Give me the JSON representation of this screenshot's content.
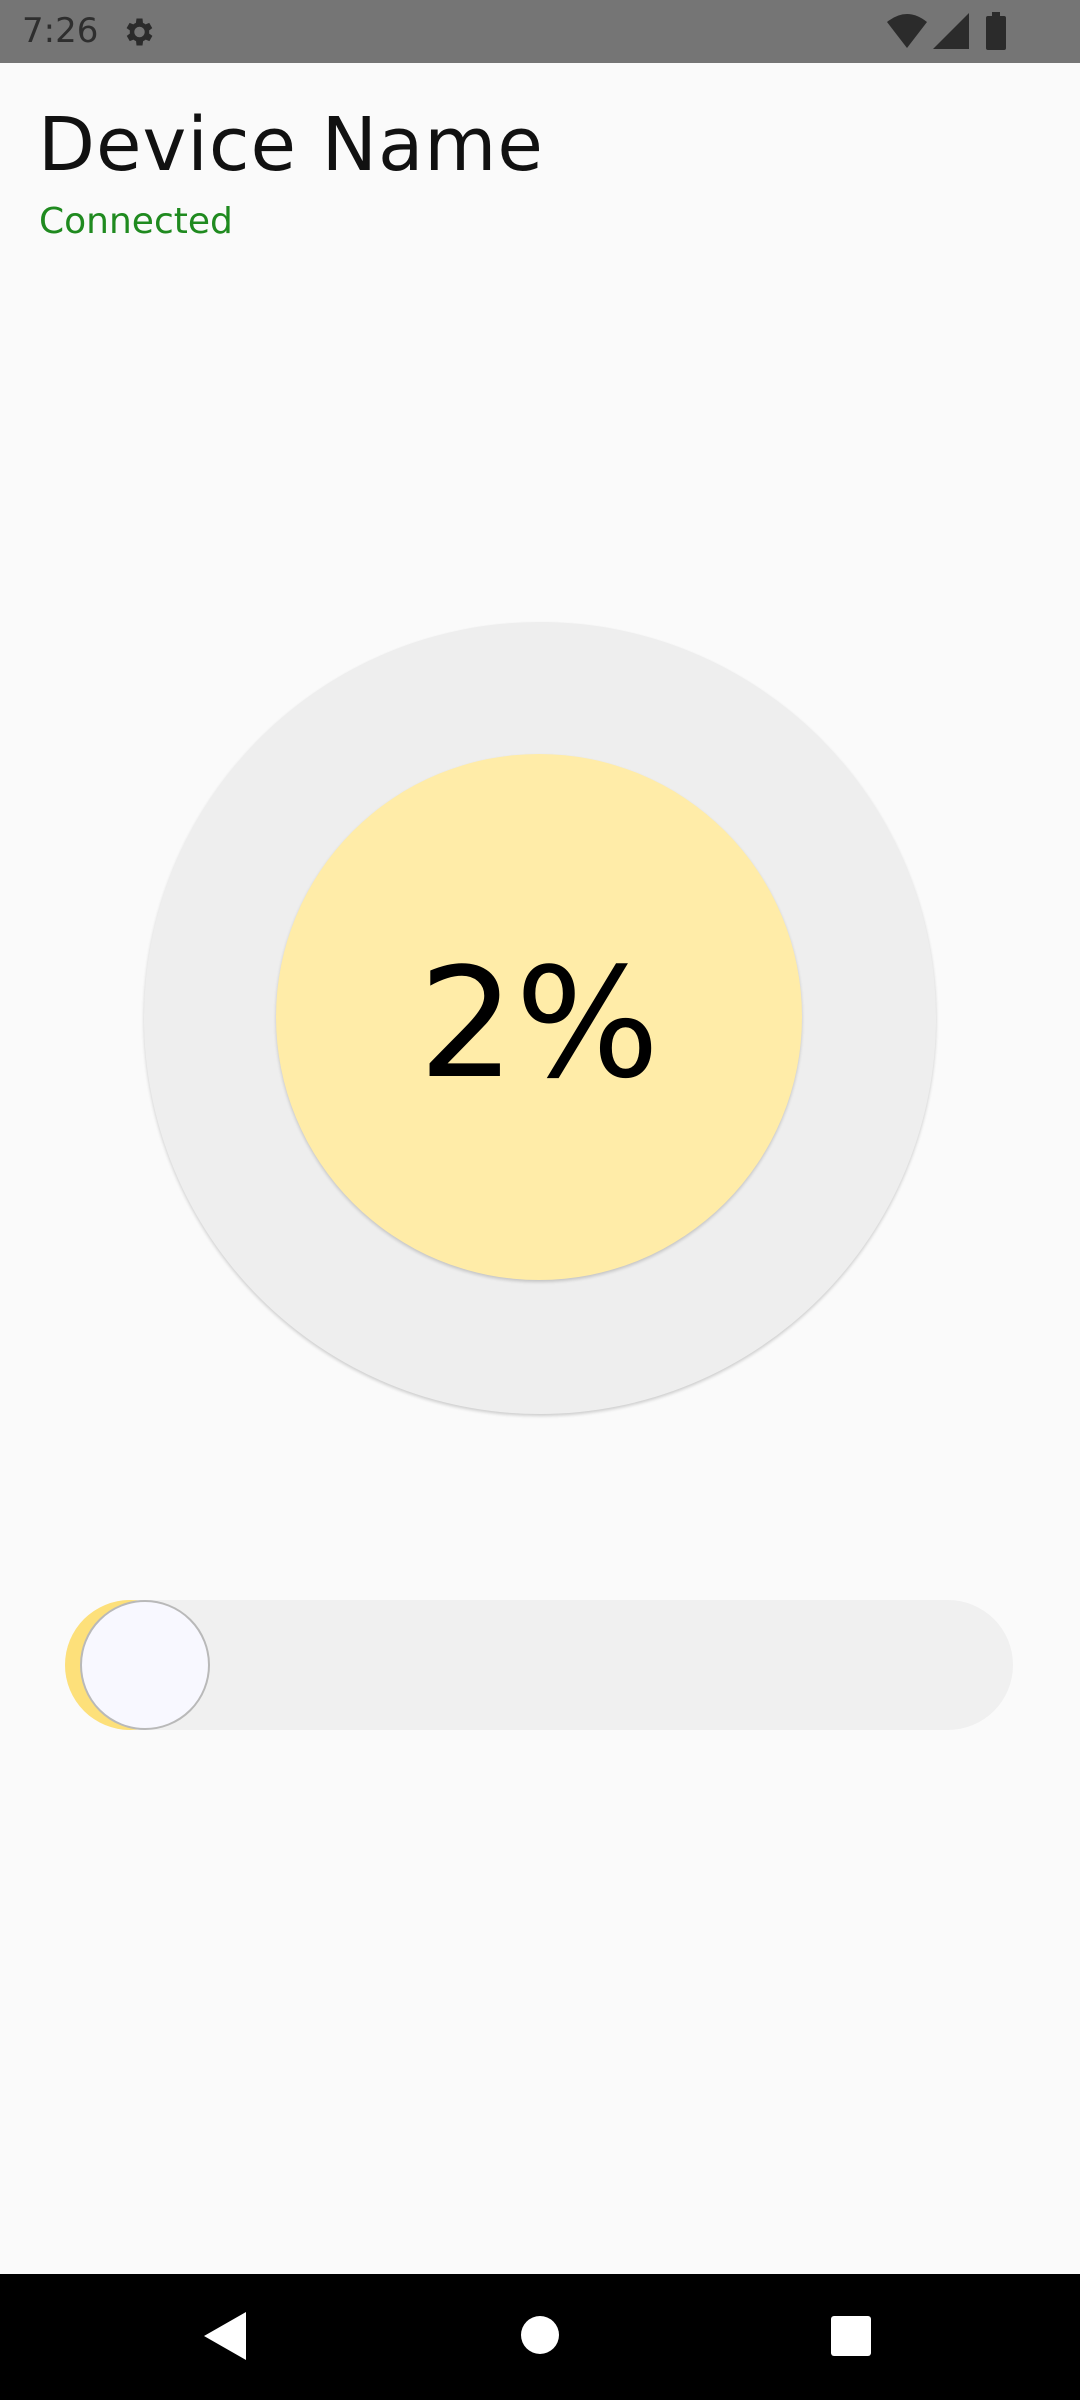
{
  "status_bar": {
    "time": "7:26",
    "icons": [
      "gear-icon",
      "wifi-icon",
      "cell-signal-icon",
      "battery-icon"
    ]
  },
  "device": {
    "name": "Device Name",
    "connection_status": "Connected",
    "status_color": "#1f8a1f"
  },
  "dial": {
    "value_text": "2%",
    "level_percent": 2,
    "accent_color": "#ffeca8"
  },
  "slider": {
    "value_percent": 2,
    "fill_color": "#fde07a"
  },
  "nav_bar": {
    "icons": [
      "back-icon",
      "home-icon",
      "recents-icon"
    ]
  }
}
